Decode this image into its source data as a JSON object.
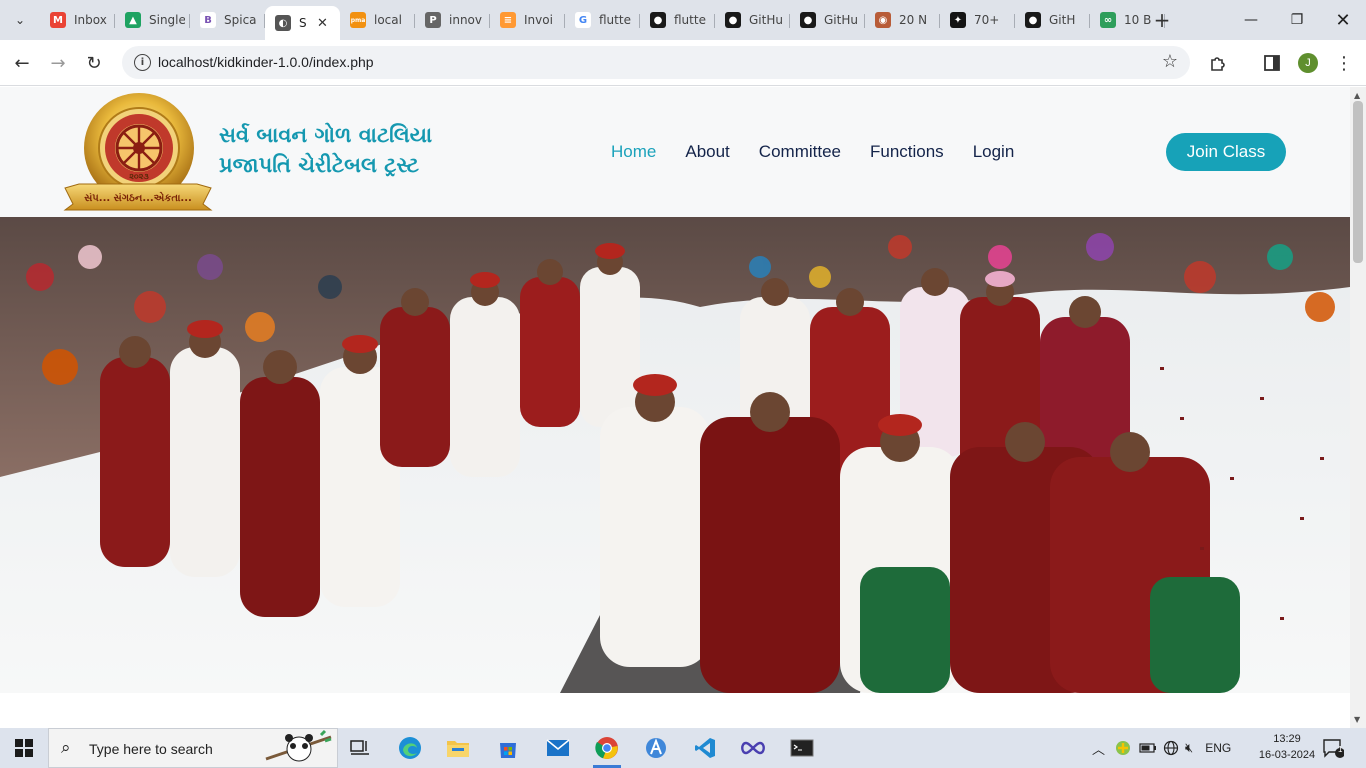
{
  "browser": {
    "tabs": [
      {
        "title": "Inbox",
        "icon": "gmail-icon",
        "color": "#ea4335",
        "glyph": "M"
      },
      {
        "title": "Single",
        "icon": "drive-icon",
        "color": "#1ea362",
        "glyph": "▲"
      },
      {
        "title": "Spica",
        "icon": "bootstrap-icon",
        "color": "#ffffff",
        "glyph": "B"
      },
      {
        "title": "S",
        "icon": "globe-icon",
        "color": "#555555",
        "glyph": "◐",
        "active": true
      },
      {
        "title": "local",
        "icon": "phpmyadmin-icon",
        "color": "#f29111",
        "glyph": "pma"
      },
      {
        "title": "innov",
        "icon": "p-icon",
        "color": "#666666",
        "glyph": "P"
      },
      {
        "title": "Invoi",
        "icon": "invoice-icon",
        "color": "#ff9933",
        "glyph": "≡"
      },
      {
        "title": "flutte",
        "icon": "google-icon",
        "color": "#ffffff",
        "glyph": "G"
      },
      {
        "title": "flutte",
        "icon": "github-icon",
        "color": "#1a1a1a",
        "glyph": "●"
      },
      {
        "title": "GitHu",
        "icon": "github-icon",
        "color": "#1a1a1a",
        "glyph": "●"
      },
      {
        "title": "GitHu",
        "icon": "github-icon",
        "color": "#1a1a1a",
        "glyph": "●"
      },
      {
        "title": "20 N",
        "icon": "cookie-icon",
        "color": "#b85c38",
        "glyph": "◉"
      },
      {
        "title": "70+",
        "icon": "star-logo-icon",
        "color": "#141414",
        "glyph": "✦"
      },
      {
        "title": "GitH",
        "icon": "github-icon",
        "color": "#1a1a1a",
        "glyph": "●"
      },
      {
        "title": "10 B",
        "icon": "link-icon",
        "color": "#2e9e5b",
        "glyph": "∞"
      }
    ],
    "url": "localhost/kidkinder-1.0.0/index.php",
    "profile_initial": "J"
  },
  "site": {
    "brand_line1": "સર્વ બાવન ગોળ વાટલિયા",
    "brand_line2": "પ્રજાપતિ ચેરીટેબલ ટ્રસ્ટ",
    "logo_motto": "સંપ... સંગઠન...એકતા...",
    "logo_year": "૨૦૨૩",
    "nav": [
      {
        "label": "Home",
        "active": true
      },
      {
        "label": "About"
      },
      {
        "label": "Committee"
      },
      {
        "label": "Functions"
      },
      {
        "label": "Login"
      }
    ],
    "cta": "Join Class",
    "accent": "#17a2b8"
  },
  "taskbar": {
    "search_placeholder": "Type here to search",
    "language": "ENG",
    "time": "13:29",
    "date": "16-03-2024",
    "notification_count": "1"
  }
}
